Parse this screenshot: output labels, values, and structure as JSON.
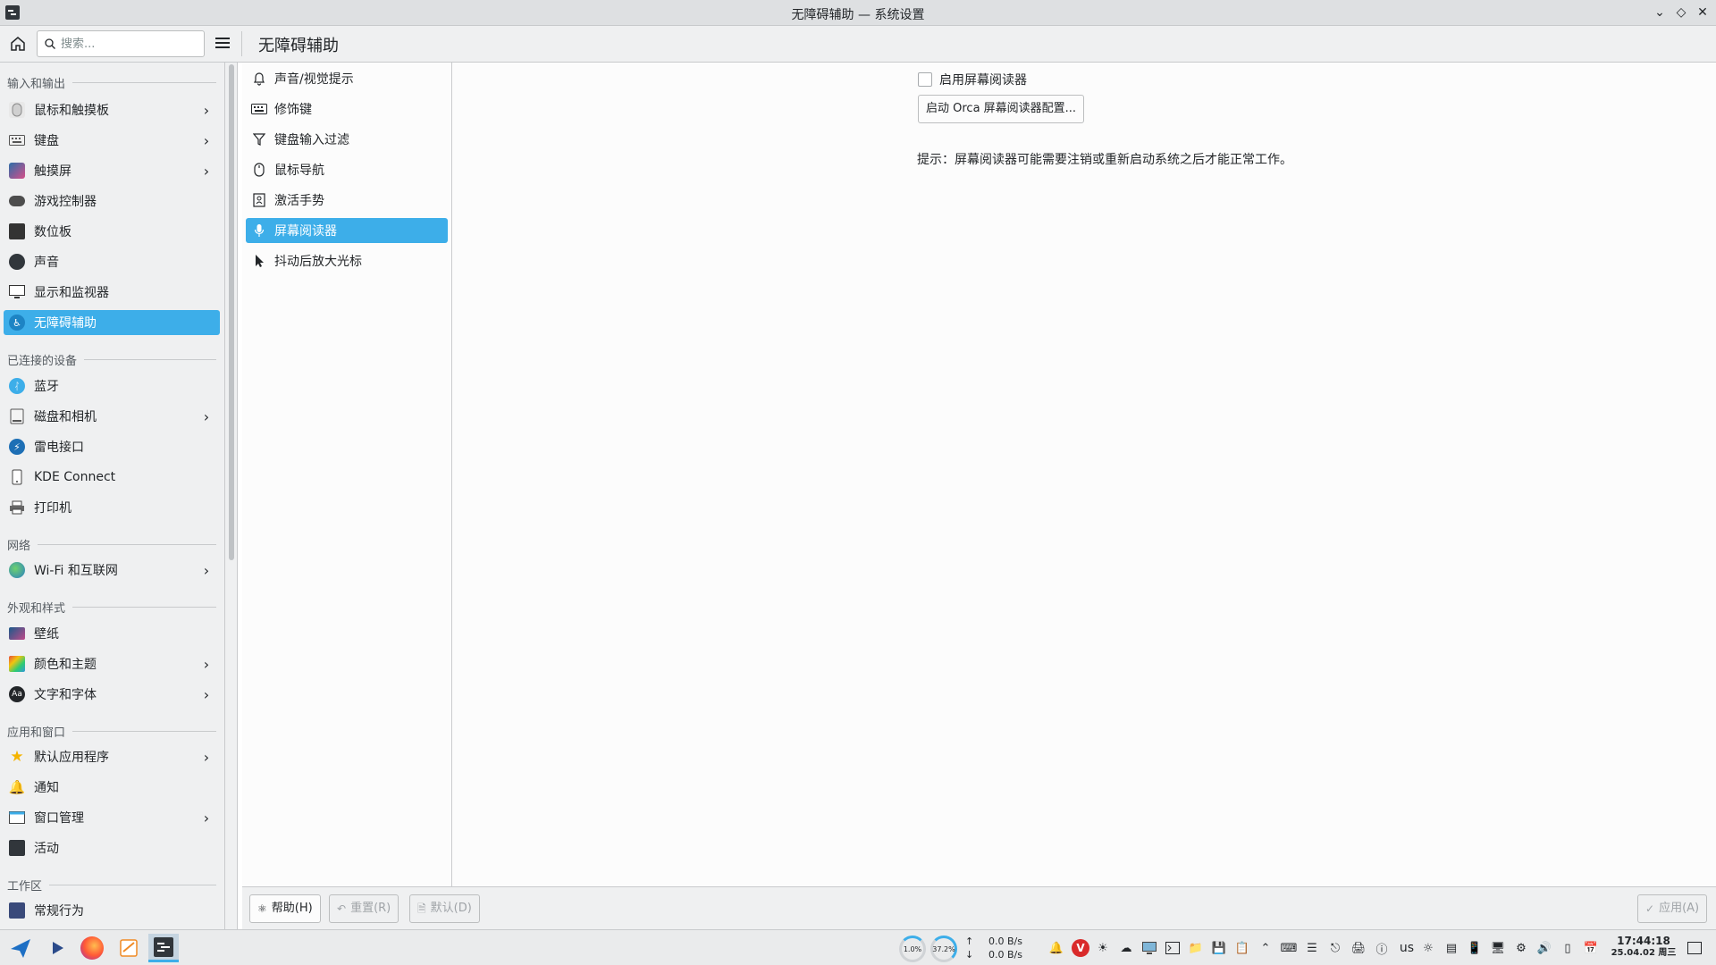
{
  "window": {
    "title": "无障碍辅助 — 系统设置"
  },
  "header": {
    "search_placeholder": "搜索...",
    "page_title": "无障碍辅助"
  },
  "sidebar": {
    "sections": [
      {
        "label": "输入和输出"
      },
      {
        "label": "已连接的设备"
      },
      {
        "label": "网络"
      },
      {
        "label": "外观和样式"
      },
      {
        "label": "应用和窗口"
      },
      {
        "label": "工作区"
      }
    ],
    "items": [
      {
        "label": "鼠标和触摸板",
        "icon": "mouse-icon",
        "has_children": true
      },
      {
        "label": "键盘",
        "icon": "keyboard-icon",
        "has_children": true
      },
      {
        "label": "触摸屏",
        "icon": "touchscreen-icon",
        "has_children": true
      },
      {
        "label": "游戏控制器",
        "icon": "gamepad-icon",
        "has_children": false
      },
      {
        "label": "数位板",
        "icon": "tablet-icon",
        "has_children": false
      },
      {
        "label": "声音",
        "icon": "speaker-icon",
        "has_children": false
      },
      {
        "label": "显示和监视器",
        "icon": "monitor-icon",
        "has_children": false
      },
      {
        "label": "无障碍辅助",
        "icon": "accessibility-icon",
        "has_children": false,
        "active": true
      },
      {
        "label": "蓝牙",
        "icon": "bluetooth-icon",
        "has_children": false
      },
      {
        "label": "磁盘和相机",
        "icon": "disk-icon",
        "has_children": true
      },
      {
        "label": "雷电接口",
        "icon": "thunderbolt-icon",
        "has_children": false
      },
      {
        "label": "KDE Connect",
        "icon": "phone-icon",
        "has_children": false
      },
      {
        "label": "打印机",
        "icon": "printer-icon",
        "has_children": false
      },
      {
        "label": "Wi-Fi 和互联网",
        "icon": "globe-icon",
        "has_children": true
      },
      {
        "label": "壁纸",
        "icon": "wallpaper-icon",
        "has_children": false
      },
      {
        "label": "颜色和主题",
        "icon": "palette-icon",
        "has_children": true
      },
      {
        "label": "文字和字体",
        "icon": "font-icon",
        "has_children": true
      },
      {
        "label": "默认应用程序",
        "icon": "star-icon",
        "has_children": true
      },
      {
        "label": "通知",
        "icon": "bell-icon",
        "has_children": false
      },
      {
        "label": "窗口管理",
        "icon": "window-icon",
        "has_children": true
      },
      {
        "label": "活动",
        "icon": "activities-icon",
        "has_children": false
      },
      {
        "label": "常规行为",
        "icon": "sliders-icon",
        "has_children": false
      }
    ]
  },
  "midlist": {
    "items": [
      {
        "label": "声音/视觉提示",
        "icon": "bell-icon"
      },
      {
        "label": "修饰键",
        "icon": "keyboard-icon"
      },
      {
        "label": "键盘输入过滤",
        "icon": "filter-icon"
      },
      {
        "label": "鼠标导航",
        "icon": "mouse-icon"
      },
      {
        "label": "激活手势",
        "icon": "gesture-icon"
      },
      {
        "label": "屏幕阅读器",
        "icon": "microphone-icon",
        "active": true
      },
      {
        "label": "抖动后放大光标",
        "icon": "cursor-icon"
      }
    ]
  },
  "content": {
    "enable_screen_reader_label": "启用屏幕阅读器",
    "enable_screen_reader_checked": false,
    "orca_button_label": "启动 Orca 屏幕阅读器配置...",
    "hint_text": "提示：屏幕阅读器可能需要注销或重新启动系统之后才能正常工作。"
  },
  "bottombar": {
    "help_label": "帮助(H)",
    "reset_label": "重置(R)",
    "defaults_label": "默认(D)",
    "apply_label": "应用(A)"
  },
  "taskbar": {
    "cpu_gauge": "1.0%",
    "mem_gauge": "37.2%",
    "net_up": "0.0 B/s",
    "net_down": "0.0 B/s",
    "keyboard_layout": "us",
    "time": "17:44:18",
    "date": "25.04.02 周三"
  },
  "colors": {
    "accent": "#3daee9",
    "window_bg": "#eff0f1",
    "view_bg": "#fcfcfc"
  }
}
